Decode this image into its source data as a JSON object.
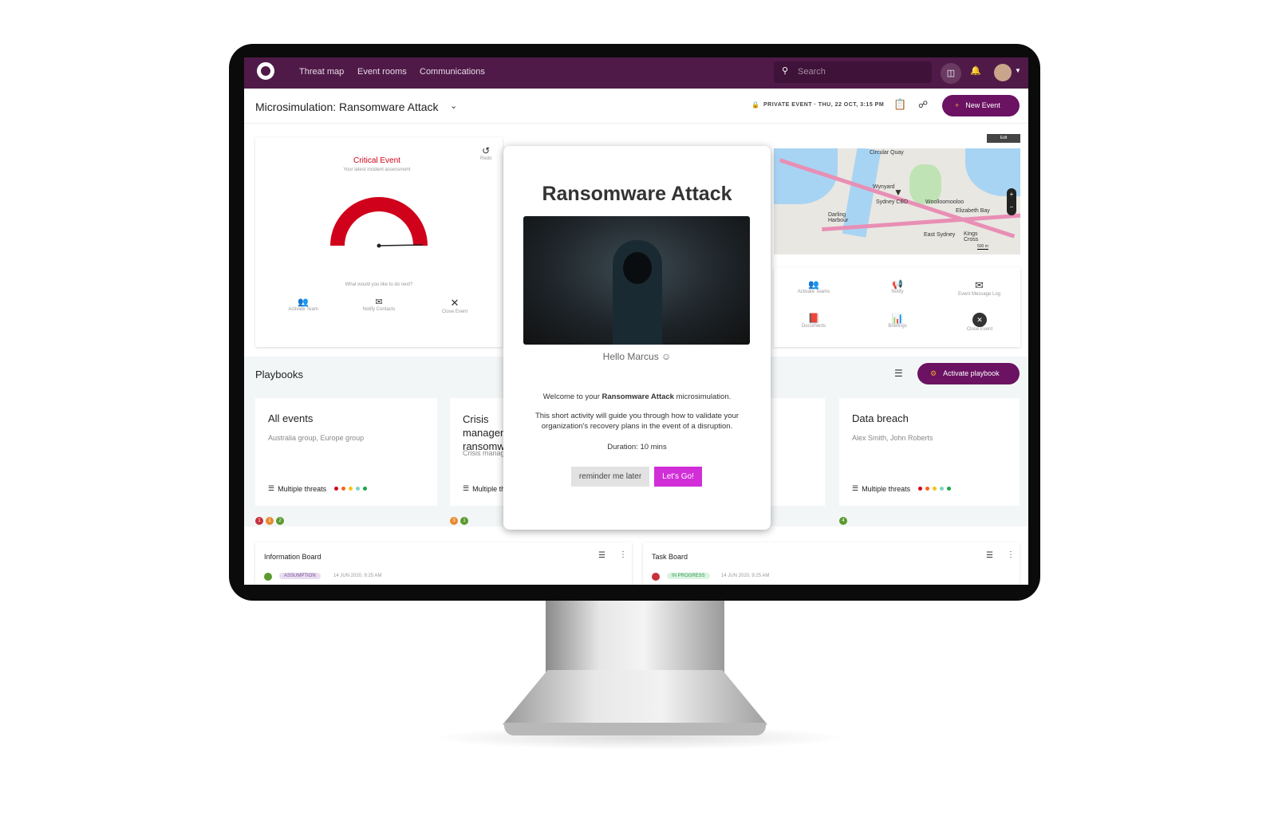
{
  "colors": {
    "nav": "#4f1a48",
    "accent": "#6b1262",
    "critical": "#d0021b",
    "cta": "#d12ed8"
  },
  "nav": {
    "links": [
      "Threat map",
      "Event rooms",
      "Communications"
    ],
    "search_placeholder": "Search"
  },
  "subheader": {
    "title": "Microsimulation: Ransomware Attack",
    "meta": "PRIVATE EVENT · THU, 22 OCT, 3:15 PM",
    "new_event": "New Event"
  },
  "assessment": {
    "title": "Critical Event",
    "subtitle": "Your latest incident assessment",
    "redo": "Redo",
    "prompt": "What would you like to do next?",
    "actions": [
      "Activate Team",
      "Notify Contacts",
      "Close Event"
    ]
  },
  "map": {
    "edit": "Edit",
    "labels": [
      "Circular Quay",
      "Wynyard",
      "Sydney CBD",
      "Woolloomooloo",
      "Elizabeth Bay",
      "Darling Harbour",
      "East Sydney",
      "Kings Cross"
    ],
    "scale": "500 m"
  },
  "event_actions": [
    "Activate Teams",
    "Notify",
    "Event Message Log",
    "Documents",
    "Briefings",
    "Close Event"
  ],
  "playbooks": {
    "title": "Playbooks",
    "activate": "Activate playbook",
    "cards": [
      {
        "title": "All events",
        "subtitle": "Australia group, Europe group",
        "threats": "Multiple threats",
        "badges": [
          "1",
          "1",
          "2"
        ]
      },
      {
        "title": "Crisis management ransomware",
        "subtitle": "Crisis management",
        "threats": "Multiple threats",
        "badges": [
          "3",
          "1"
        ]
      },
      {
        "title": "Data breach",
        "subtitle": "Alex Smith, John Roberts",
        "threats": "Multiple threats",
        "badges": [
          "4"
        ]
      }
    ]
  },
  "boards": [
    {
      "title": "Information Board",
      "tag": "ASSUMPTION",
      "time": "14 JUN 2020, 9:25 AM"
    },
    {
      "title": "Task Board",
      "tag": "IN PROGRESS",
      "time": "14 JUN 2020, 9:25 AM"
    }
  ],
  "modal": {
    "title": "Ransomware Attack",
    "greeting": "Hello Marcus",
    "welcome_pre": "Welcome to your ",
    "welcome_bold": "Ransomware Attack",
    "welcome_post": " microsimulation.",
    "body": "This short activity will guide you through how to validate your organization's recovery plans in the event of a disruption.",
    "duration": "Duration: 10 mins",
    "later": "reminder me later",
    "go": "Let's Go!"
  }
}
